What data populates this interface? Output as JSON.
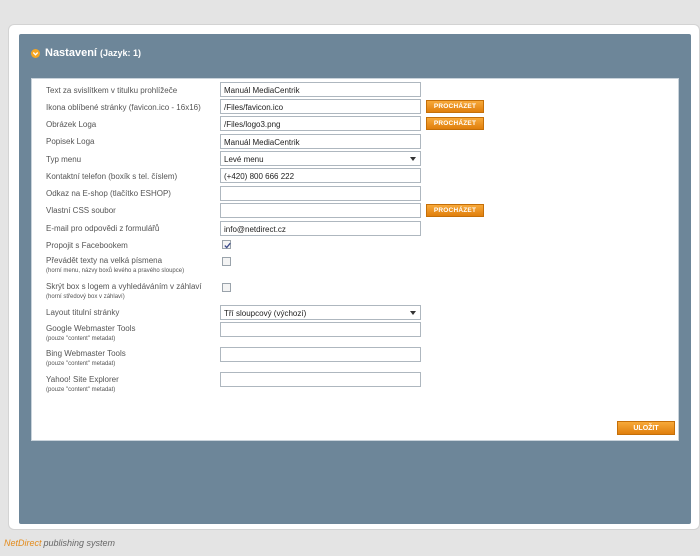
{
  "header": {
    "title": "Nastavení",
    "lang": "(Jazyk: 1)"
  },
  "form": {
    "fields": [
      {
        "label": "Text za svislítkem v titulku prohlížeče",
        "type": "text",
        "value": "Manuál MediaCentrik"
      },
      {
        "label": "Ikona oblíbené stránky (favicon.ico - 16x16)",
        "type": "text",
        "value": "/Files/favicon.ico",
        "button": "PROCHÁZET"
      },
      {
        "label": "Obrázek Loga",
        "type": "text",
        "value": "/Files/logo3.png",
        "button": "PROCHÁZET"
      },
      {
        "label": "Popisek Loga",
        "type": "text",
        "value": "Manuál MediaCentrik"
      },
      {
        "label": "Typ menu",
        "type": "select",
        "value": "Levé menu"
      },
      {
        "label": "Kontaktní telefon (boxík s tel. číslem)",
        "type": "text",
        "value": "(+420) 800 666 222"
      },
      {
        "label": "Odkaz na E-shop (tlačítko ESHOP)",
        "type": "text",
        "value": ""
      },
      {
        "label": "Vlastní CSS soubor",
        "type": "text",
        "value": "",
        "button": "PROCHÁZET"
      },
      {
        "label": "E-mail pro odpovědi z formulářů",
        "type": "text",
        "value": "info@netdirect.cz"
      },
      {
        "label": "Propojit s Facebookem",
        "type": "checkbox",
        "checked": true
      },
      {
        "label": "Převádět texty na velká písmena",
        "sublabel": "(horní menu, názvy boxů levého a pravého sloupce)",
        "type": "checkbox",
        "checked": false
      },
      {
        "label": "Skrýt box s logem a vyhledáváním v záhlaví",
        "sublabel": "(horní středový box v záhlaví)",
        "type": "checkbox",
        "checked": false
      },
      {
        "label": "Layout titulní stránky",
        "type": "select",
        "value": "Tří sloupcový (výchozí)"
      },
      {
        "label": "Google Webmaster Tools",
        "sublabel": "(pouze \"content\" metadat)",
        "type": "text",
        "value": ""
      },
      {
        "label": "Bing Webmaster Tools",
        "sublabel": "(pouze \"content\" metadat)",
        "type": "text",
        "value": ""
      },
      {
        "label": "Yahoo! Site Explorer",
        "sublabel": "(pouze \"content\" metadat)",
        "type": "text",
        "value": ""
      }
    ]
  },
  "actions": {
    "save_label": "ULOŽIT"
  },
  "footer": {
    "brand_net": "NetDirect",
    "brand_ps": "publishing system"
  },
  "icons": {
    "header": "chevron-down-circle-icon",
    "checkbox_mark": "checkmark-icon"
  },
  "colors": {
    "panel": "#6d8699",
    "accent": "#f39a23",
    "background": "#e4e4e4"
  }
}
